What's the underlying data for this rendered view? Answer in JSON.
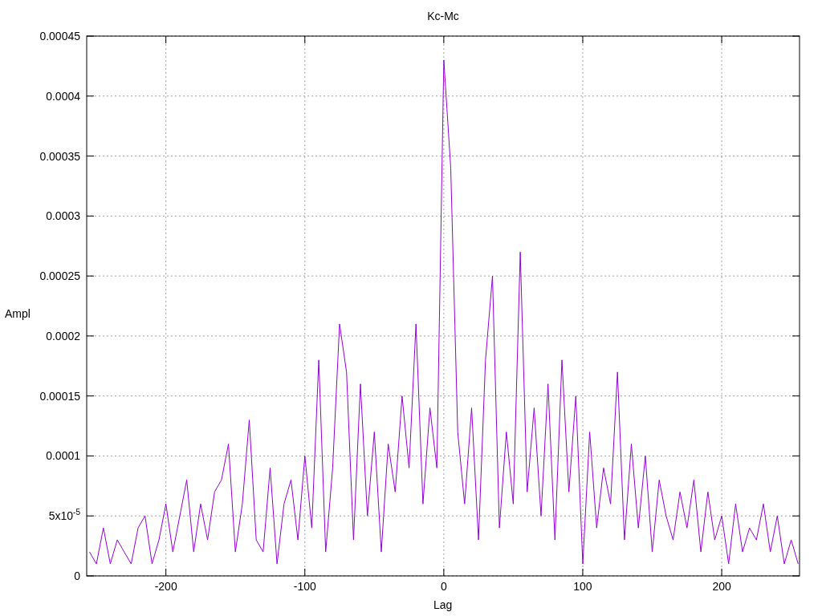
{
  "chart_data": {
    "type": "line",
    "title": "Kc-Mc",
    "xlabel": "Lag",
    "ylabel": "Ampl",
    "x": [
      -255,
      -250,
      -245,
      -240,
      -235,
      -230,
      -225,
      -220,
      -215,
      -210,
      -205,
      -200,
      -195,
      -190,
      -185,
      -180,
      -175,
      -170,
      -165,
      -160,
      -155,
      -150,
      -145,
      -140,
      -135,
      -130,
      -125,
      -120,
      -115,
      -110,
      -105,
      -100,
      -95,
      -90,
      -85,
      -80,
      -75,
      -70,
      -65,
      -60,
      -55,
      -50,
      -45,
      -40,
      -35,
      -30,
      -25,
      -20,
      -15,
      -10,
      -5,
      0,
      5,
      10,
      15,
      20,
      25,
      30,
      35,
      40,
      45,
      50,
      55,
      60,
      65,
      70,
      75,
      80,
      85,
      90,
      95,
      100,
      105,
      110,
      115,
      120,
      125,
      130,
      135,
      140,
      145,
      150,
      155,
      160,
      165,
      170,
      175,
      180,
      185,
      190,
      195,
      200,
      205,
      210,
      215,
      220,
      225,
      230,
      235,
      240,
      245,
      250,
      255
    ],
    "grid": true,
    "series": [
      {
        "color": "#9400d3",
        "values": [
          2e-05,
          1e-05,
          4e-05,
          1e-05,
          3e-05,
          2e-05,
          1e-05,
          4e-05,
          5e-05,
          1e-05,
          3e-05,
          6e-05,
          2e-05,
          5e-05,
          8e-05,
          2e-05,
          6e-05,
          3e-05,
          7e-05,
          8e-05,
          0.00011,
          2e-05,
          6e-05,
          0.00013,
          3e-05,
          2e-05,
          9e-05,
          1e-05,
          6e-05,
          8e-05,
          3e-05,
          0.0001,
          4e-05,
          0.00018,
          2e-05,
          9e-05,
          0.00021,
          0.00017,
          3e-05,
          0.00016,
          5e-05,
          0.00012,
          2e-05,
          0.00011,
          7e-05,
          0.00015,
          9e-05,
          0.00021,
          6e-05,
          0.00014,
          9e-05,
          0.00043,
          0.00034,
          0.00012,
          6e-05,
          0.00014,
          3e-05,
          0.00018,
          0.00025,
          4e-05,
          0.00012,
          6e-05,
          0.00027,
          7e-05,
          0.00014,
          5e-05,
          0.00016,
          3e-05,
          0.00018,
          7e-05,
          0.00015,
          1e-05,
          0.00012,
          4e-05,
          9e-05,
          6e-05,
          0.00017,
          3e-05,
          0.00011,
          4e-05,
          0.0001,
          2e-05,
          8e-05,
          5e-05,
          3e-05,
          7e-05,
          4e-05,
          8e-05,
          2e-05,
          7e-05,
          3e-05,
          5e-05,
          1e-05,
          6e-05,
          2e-05,
          4e-05,
          3e-05,
          6e-05,
          2e-05,
          5e-05,
          1e-05,
          3e-05,
          1e-05
        ]
      }
    ],
    "xlim": [
      -257,
      256
    ],
    "ylim": [
      0,
      0.00045
    ],
    "xticks": [
      -200,
      -100,
      0,
      100,
      200
    ],
    "yticks": [
      0,
      {
        "value": 5e-05,
        "label": "5x10$^{-5}$"
      },
      0.0001,
      0.00015,
      0.0002,
      0.00025,
      0.0003,
      0.00035,
      0.0004,
      0.00045
    ]
  }
}
